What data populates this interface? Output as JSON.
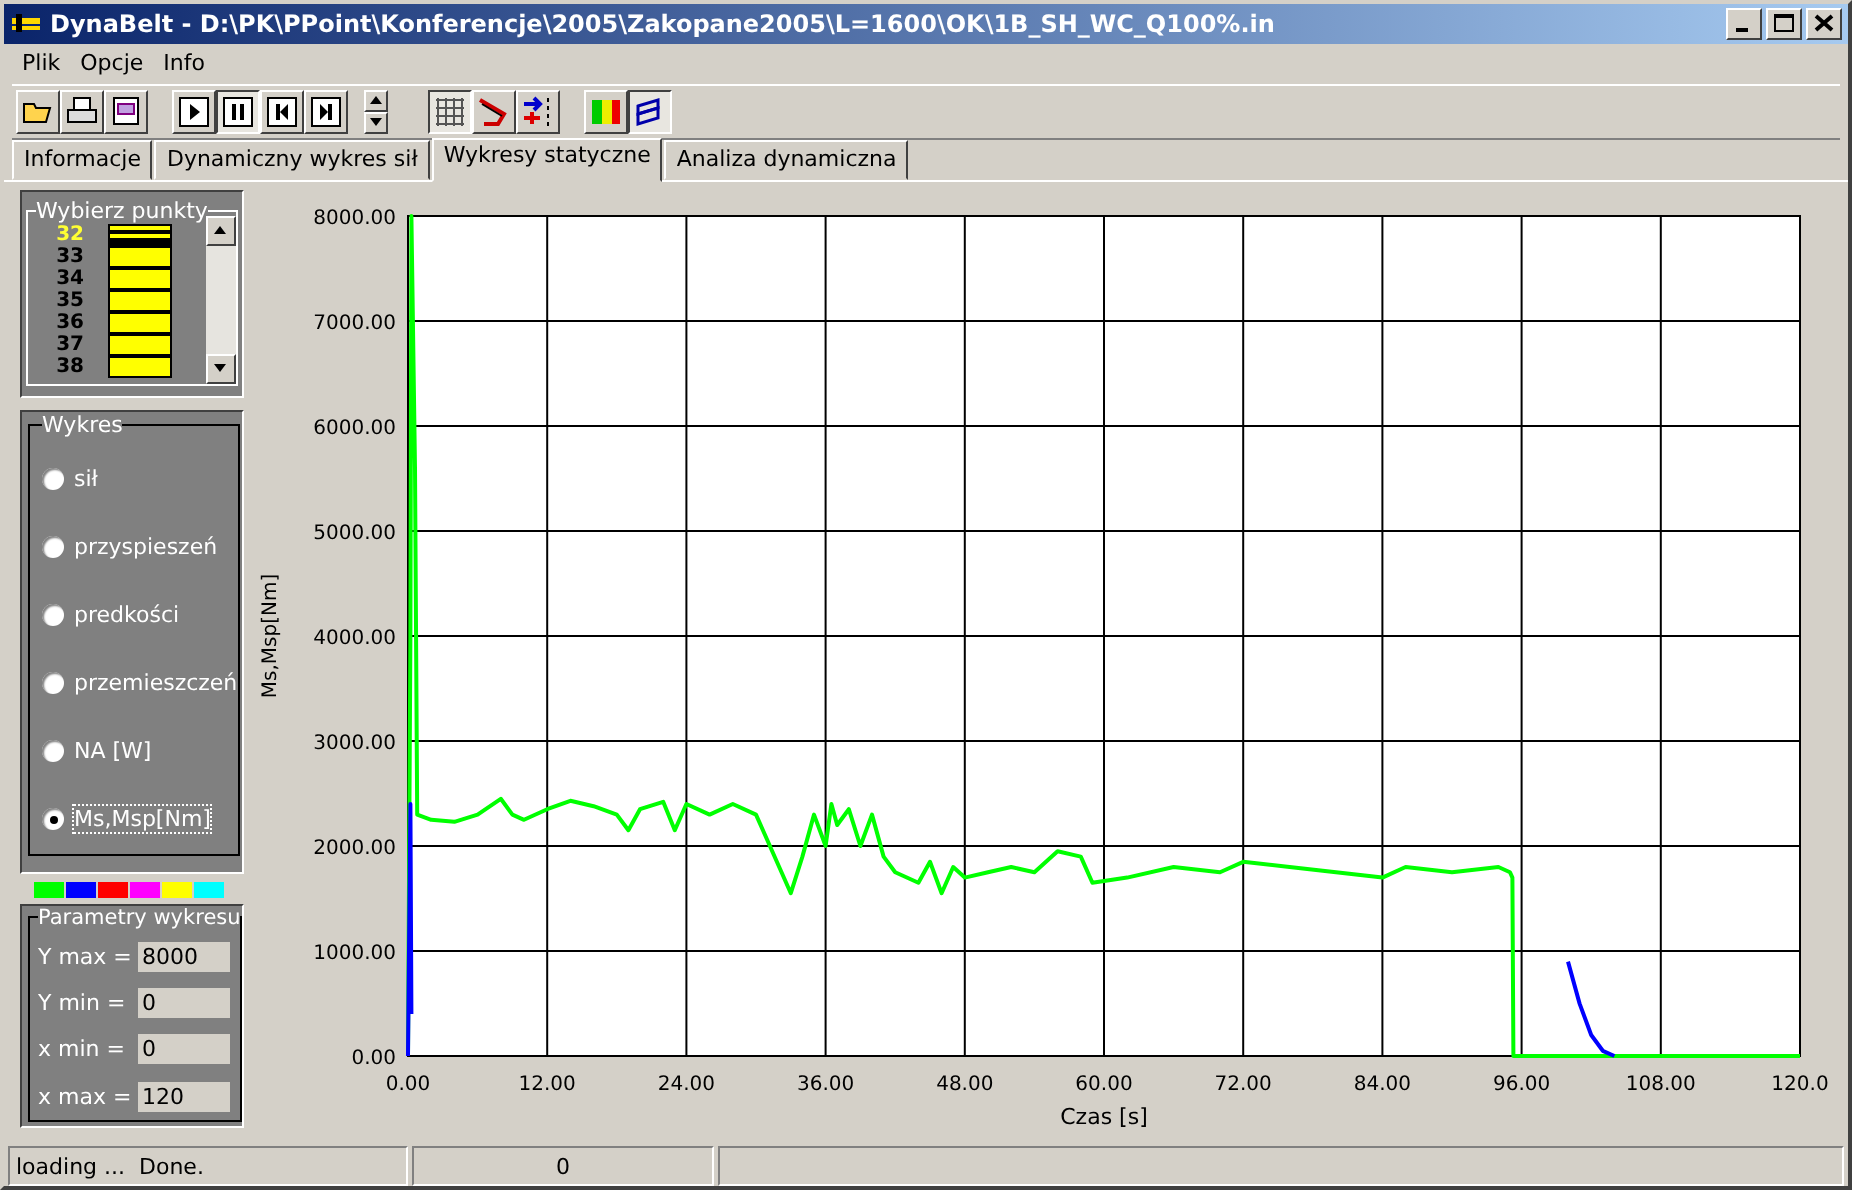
{
  "window": {
    "title": "DynaBelt - D:\\PK\\PPoint\\Konferencje\\2005\\Zakopane2005\\L=1600\\OK\\1B_SH_WC_Q100%.in"
  },
  "menu": [
    "Plik",
    "Opcje",
    "Info"
  ],
  "toolbar": [
    {
      "kind": "open",
      "pressed": false
    },
    {
      "kind": "print",
      "pressed": false
    },
    {
      "kind": "report",
      "pressed": false
    },
    {
      "kind": "sep"
    },
    {
      "kind": "play",
      "pressed": false
    },
    {
      "kind": "pause",
      "pressed": true
    },
    {
      "kind": "back",
      "pressed": false
    },
    {
      "kind": "forward",
      "pressed": false
    },
    {
      "kind": "spin"
    },
    {
      "kind": "sep"
    },
    {
      "kind": "grid",
      "pressed": true
    },
    {
      "kind": "belt",
      "pressed": false
    },
    {
      "kind": "arrows",
      "pressed": false
    },
    {
      "kind": "sep"
    },
    {
      "kind": "colors",
      "pressed": false
    },
    {
      "kind": "layers",
      "pressed": true
    }
  ],
  "tabs": [
    {
      "label": "Informacje",
      "selected": false
    },
    {
      "label": "Dynamiczny wykres sił",
      "selected": false
    },
    {
      "label": "Wykresy statyczne",
      "selected": true
    },
    {
      "label": "Analiza dynamiczna",
      "selected": false
    }
  ],
  "points": {
    "title": "Wybierz punkty",
    "items": [
      {
        "label": "32",
        "selected": true
      },
      {
        "label": "33",
        "selected": false
      },
      {
        "label": "34",
        "selected": false
      },
      {
        "label": "35",
        "selected": false
      },
      {
        "label": "36",
        "selected": false
      },
      {
        "label": "37",
        "selected": false
      },
      {
        "label": "38",
        "selected": false
      }
    ]
  },
  "plot_type": {
    "title": "Wykres",
    "options": [
      {
        "label": "sił",
        "selected": false
      },
      {
        "label": "przyspieszeń",
        "selected": false
      },
      {
        "label": "predkości",
        "selected": false
      },
      {
        "label": "przemieszczeń",
        "selected": false
      },
      {
        "label": "NA [W]",
        "selected": false
      },
      {
        "label": "Ms,Msp[Nm]",
        "selected": true
      }
    ]
  },
  "palette": [
    {
      "color": "#00ff00"
    },
    {
      "color": "#0000ff"
    },
    {
      "color": "#ff0000"
    },
    {
      "color": "#ff00ff"
    },
    {
      "color": "#ffff00"
    },
    {
      "color": "#00ffff"
    }
  ],
  "parameters": {
    "title": "Parametry wykresu",
    "fields": [
      {
        "label": "Y max =",
        "value": "8000"
      },
      {
        "label": "Y min =",
        "value": "0"
      },
      {
        "label": "x min =",
        "value": "0"
      },
      {
        "label": "x max =",
        "value": "120"
      }
    ]
  },
  "chart": {
    "chart_data": {
      "type": "line",
      "grid": true,
      "xlabel": "Czas [s]",
      "ylabel": "Ms,Msp[Nm]",
      "xlim": [
        0,
        120
      ],
      "ylim": [
        0,
        8000
      ],
      "xticks": [
        {
          "value": 0,
          "label": "0.00"
        },
        {
          "value": 12,
          "label": "12.00"
        },
        {
          "value": 24,
          "label": "24.00"
        },
        {
          "value": 36,
          "label": "36.00"
        },
        {
          "value": 48,
          "label": "48.00"
        },
        {
          "value": 60,
          "label": "60.00"
        },
        {
          "value": 72,
          "label": "72.00"
        },
        {
          "value": 84,
          "label": "84.00"
        },
        {
          "value": 96,
          "label": "96.00"
        },
        {
          "value": 108,
          "label": "108.00"
        },
        {
          "value": 120,
          "label": "120.0"
        }
      ],
      "yticks": [
        {
          "value": 0,
          "label": "0.00"
        },
        {
          "value": 1000,
          "label": "1000.00"
        },
        {
          "value": 2000,
          "label": "2000.00"
        },
        {
          "value": 3000,
          "label": "3000.00"
        },
        {
          "value": 4000,
          "label": "4000.00"
        },
        {
          "value": 5000,
          "label": "5000.00"
        },
        {
          "value": 6000,
          "label": "6000.00"
        },
        {
          "value": 7000,
          "label": "7000.00"
        },
        {
          "value": 8000,
          "label": "8000.00"
        }
      ],
      "x": [
        0,
        0.2,
        0.3,
        0.6,
        0.8,
        2,
        4,
        6,
        8,
        9,
        10,
        12,
        14,
        16,
        18,
        19,
        20,
        22,
        23,
        24,
        26,
        28,
        30,
        32,
        33,
        34,
        35,
        36,
        36.5,
        37,
        38,
        39,
        40,
        41,
        42,
        44,
        45,
        46,
        47,
        48,
        50,
        52,
        54,
        56,
        58,
        59,
        62,
        66,
        70,
        72,
        76,
        80,
        84,
        86,
        90,
        94,
        95,
        95.2,
        95.3,
        100,
        101,
        102,
        103,
        104,
        120
      ],
      "series": [
        {
          "color": "#00ff00",
          "values": [
            0,
            4000,
            8000,
            5600,
            2300,
            2250,
            2230,
            2300,
            2450,
            2300,
            2250,
            2350,
            2430,
            2380,
            2300,
            2150,
            2350,
            2420,
            2150,
            2400,
            2300,
            2400,
            2300,
            1800,
            1550,
            1900,
            2300,
            2000,
            2400,
            2200,
            2350,
            2000,
            2300,
            1900,
            1750,
            1650,
            1850,
            1550,
            1800,
            1700,
            1750,
            1800,
            1750,
            1950,
            1900,
            1650,
            1700,
            1800,
            1750,
            1850,
            1800,
            1750,
            1700,
            1800,
            1750,
            1800,
            1750,
            1700,
            0,
            0,
            0,
            0,
            0,
            0,
            0
          ]
        },
        {
          "color": "#0000ff",
          "values": [
            0,
            2400,
            400,
            null,
            null,
            null,
            null,
            null,
            null,
            null,
            null,
            null,
            null,
            null,
            null,
            null,
            null,
            null,
            null,
            null,
            null,
            null,
            null,
            null,
            null,
            null,
            null,
            null,
            null,
            null,
            null,
            null,
            null,
            null,
            null,
            null,
            null,
            null,
            null,
            null,
            null,
            null,
            null,
            null,
            null,
            null,
            null,
            null,
            null,
            null,
            null,
            null,
            null,
            null,
            null,
            null,
            null,
            null,
            null,
            900,
            500,
            200,
            50,
            0,
            null
          ]
        }
      ]
    }
  },
  "status_bar": [
    "loading ...  Done.",
    "0"
  ]
}
